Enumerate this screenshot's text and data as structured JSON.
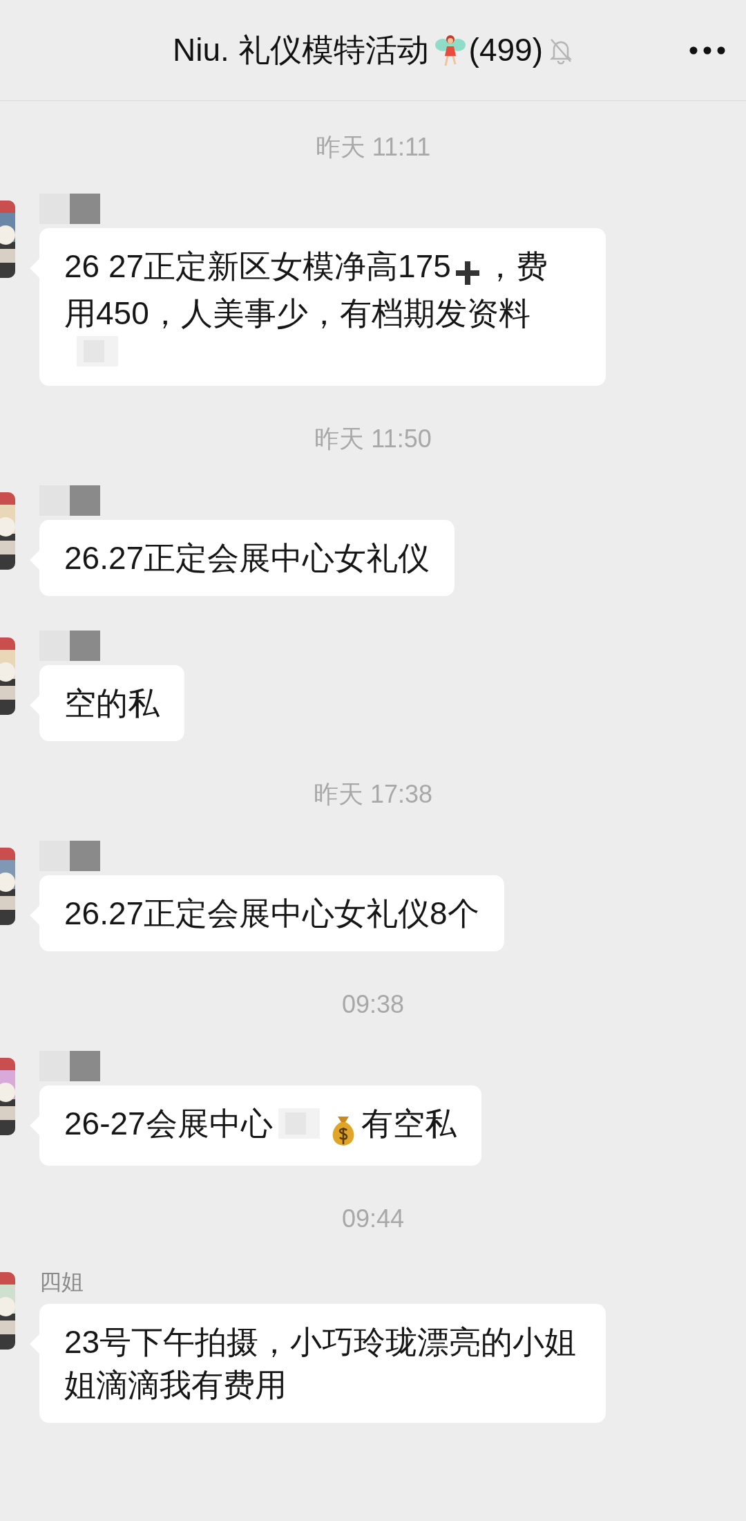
{
  "header": {
    "title": "Niu. 礼仪模特活动",
    "count": "(499)",
    "muted": true
  },
  "feed": [
    {
      "kind": "time",
      "text": "昨天 11:11"
    },
    {
      "kind": "message",
      "name_hidden": true,
      "parts": [
        {
          "kind": "text",
          "text": "26 27正定新区女模净高175"
        },
        {
          "kind": "plus"
        },
        {
          "kind": "text",
          "text": "，费"
        },
        {
          "kind": "text",
          "text": "用450，人美事少，有档期发资料"
        },
        {
          "kind": "redacted"
        }
      ]
    },
    {
      "kind": "time",
      "text": "昨天 11:50"
    },
    {
      "kind": "message",
      "name_hidden": true,
      "parts": [
        {
          "kind": "text",
          "text": "26.27正定会展中心女礼仪"
        }
      ]
    },
    {
      "kind": "message",
      "name_hidden": true,
      "parts": [
        {
          "kind": "text",
          "text": "空的私"
        }
      ]
    },
    {
      "kind": "time",
      "text": "昨天 17:38"
    },
    {
      "kind": "message",
      "name_hidden": true,
      "parts": [
        {
          "kind": "text",
          "text": "26.27正定会展中心女礼仪8个"
        }
      ]
    },
    {
      "kind": "time",
      "text": "09:38"
    },
    {
      "kind": "message",
      "name_hidden": true,
      "parts": [
        {
          "kind": "text",
          "text": "26-27会展中心"
        },
        {
          "kind": "redacted"
        },
        {
          "kind": "money"
        },
        {
          "kind": "text",
          "text": "有空私"
        }
      ]
    },
    {
      "kind": "time",
      "text": "09:44"
    },
    {
      "kind": "message",
      "name_hidden": false,
      "name": "四姐",
      "parts": [
        {
          "kind": "text",
          "text": "23号下午拍摄，小巧玲珑漂亮的小姐姐滴滴我有费用"
        }
      ]
    }
  ]
}
